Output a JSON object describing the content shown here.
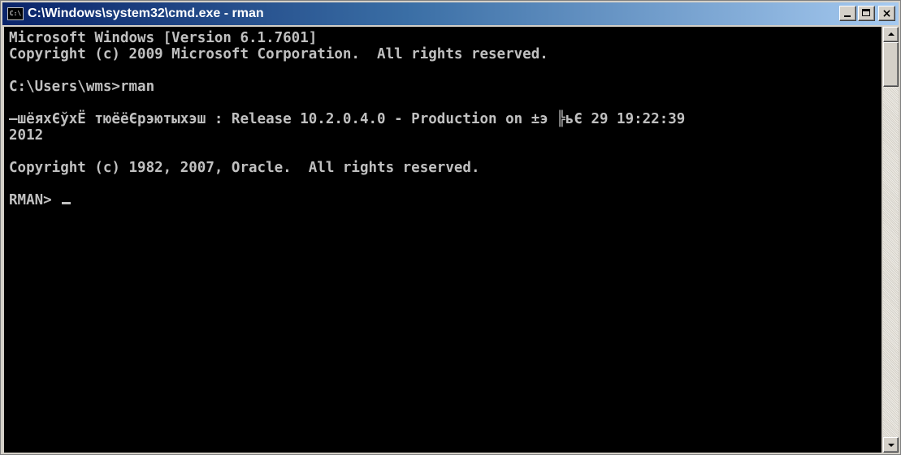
{
  "window": {
    "title": "C:\\Windows\\system32\\cmd.exe - rman",
    "icon_label": "C:\\",
    "icon_name": "cmd-icon"
  },
  "controls": {
    "minimize": "minimize-icon",
    "maximize": "maximize-icon",
    "close": "×"
  },
  "console": {
    "lines": [
      "Microsoft Windows [Version 6.1.7601]",
      "Copyright (c) 2009 Microsoft Corporation.  All rights reserved.",
      "",
      "C:\\Users\\wms>rman",
      "",
      "—шёяхЄўхЁ тюёёЄрэютыхэш : Release 10.2.0.4.0 - Production on ±э ╠ьЄ 29 19:22:39",
      "2012",
      "",
      "Copyright (c) 1982, 2007, Oracle.  All rights reserved.",
      "",
      "RMAN> "
    ],
    "text_color": "#c0c0c0",
    "background": "#000000"
  },
  "scrollbar": {
    "position": 0
  }
}
